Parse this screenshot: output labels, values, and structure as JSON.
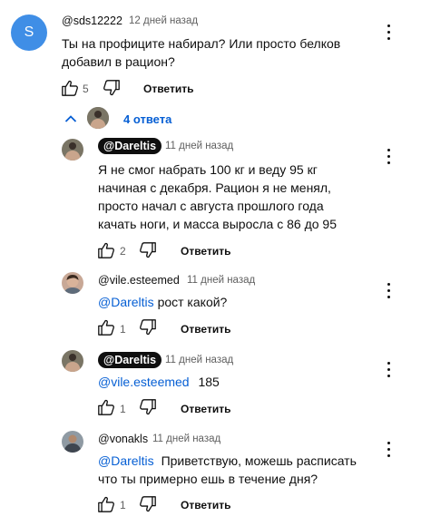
{
  "comment": {
    "avatar_letter": "S",
    "avatar_color": "#3f8ee6",
    "author": "@sds12222",
    "time": "12 дней назад",
    "text": "Ты на профиците набирал? Или просто белков добавил в рацион?",
    "likes": "5",
    "reply_label": "Ответить"
  },
  "replies_toggle": {
    "label": "4 ответа",
    "accent": "#065fd4"
  },
  "replies": [
    {
      "author": "@Dareltis",
      "is_creator": true,
      "time": "11 дней назад",
      "mention": "",
      "text": "Я не смог набрать 100 кг и веду 95 кг начиная с декабря. Рацион я не менял, просто начал с августа прошлого года качать ноги, и масса выросла с 86 до 95",
      "likes": "2",
      "reply_label": "Ответить"
    },
    {
      "author": "@vile.esteemed",
      "is_creator": false,
      "time": "11 дней назад",
      "mention": "@Dareltis",
      "text": "рост какой?",
      "likes": "1",
      "reply_label": "Ответить"
    },
    {
      "author": "@Dareltis",
      "is_creator": true,
      "time": "11 дней назад",
      "mention": "@vile.esteemed",
      "text": "185",
      "likes": "1",
      "reply_label": "Ответить"
    },
    {
      "author": "@vonakls",
      "is_creator": false,
      "time": "11 дней назад",
      "mention": "@Dareltis",
      "text": "Приветствую, можешь расписать что ты примерно ешь в течение дня?",
      "likes": "1",
      "reply_label": "Ответить"
    }
  ],
  "icons": {
    "like": "thumb-up-icon",
    "dislike": "thumb-down-icon",
    "more": "more-vertical-icon",
    "toggle": "chevron-up-icon"
  }
}
